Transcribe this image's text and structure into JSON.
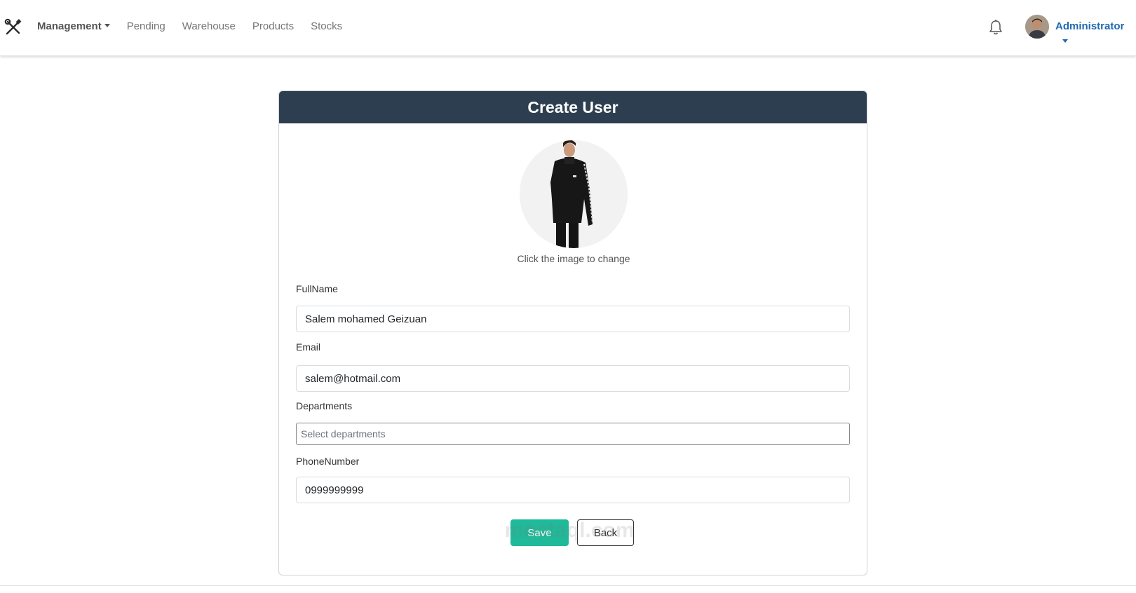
{
  "navbar": {
    "brand_icon": "tools-icon",
    "links": [
      {
        "label": "Management",
        "dropdown": true
      },
      {
        "label": "Pending"
      },
      {
        "label": "Warehouse"
      },
      {
        "label": "Products"
      },
      {
        "label": "Stocks"
      }
    ],
    "notification_icon": "bell-icon",
    "user_name": "Administrator"
  },
  "form": {
    "title": "Create User",
    "photo_hint": "Click the image to change",
    "fullname_label": "FullName",
    "fullname_value": "Salem mohamed Geizuan",
    "email_label": "Email",
    "email_value": "salem@hotmail.com",
    "departments_label": "Departments",
    "departments_placeholder": "Select departments",
    "phone_label": "PhoneNumber",
    "phone_value": "0999999999",
    "save_label": "Save",
    "back_label": "Back"
  },
  "watermark": "mostaql.com",
  "colors": {
    "header_bg": "#2d3e50",
    "save_bg": "#20b999",
    "user_link": "#1f69b0"
  }
}
